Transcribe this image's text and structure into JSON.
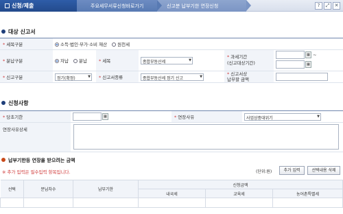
{
  "header": {
    "home_label": "신청/제출",
    "crumb1": "주요세무서류신청바로가기",
    "crumb2": "신고분 납부기한 연장신청",
    "buttons": [
      "?",
      "⤢",
      "✕"
    ]
  },
  "section1": {
    "title": "대상 신고서",
    "tax_type": {
      "label": "세목구분",
      "options": [
        "소득·법인·부가·소비 재산",
        "원천세"
      ],
      "selected": 0
    },
    "installment": {
      "label": "분납구분",
      "options": [
        "자납",
        "분납"
      ],
      "selected": 0
    },
    "tax_item": {
      "label": "세목",
      "value": "종합부동산세"
    },
    "tax_period": {
      "label": "과세기간",
      "sub": "(신고대상기간)",
      "tilde": "~"
    },
    "return_type": {
      "label": "신고구분",
      "value": "정기(확정)"
    },
    "return_kind": {
      "label": "신고서종류",
      "value": "종합부동산세 정기 신고"
    },
    "amount": {
      "label": "신고서상",
      "sub": "납부할 금액"
    }
  },
  "section2": {
    "title": "신청사항",
    "due_date": {
      "label": "당초기한"
    },
    "reason": {
      "label": "연장사유",
      "value": "사업상중대위기"
    },
    "detail": {
      "label": "연장사유상세"
    }
  },
  "section3": {
    "title": "납부기한등 연장을 받으려는 금액",
    "note": "※ 추가 입력은 필수입력 항목입니다.",
    "unit": "(단위:원)",
    "add_button": "추가 입력",
    "delete_button": "선택내용 삭제",
    "columns": {
      "select": "선택",
      "installment_no": "분납차수",
      "due": "납부기한",
      "amount_group": "신청금액",
      "national": "내국세",
      "education": "교육세",
      "rural": "농어촌특별세"
    }
  }
}
